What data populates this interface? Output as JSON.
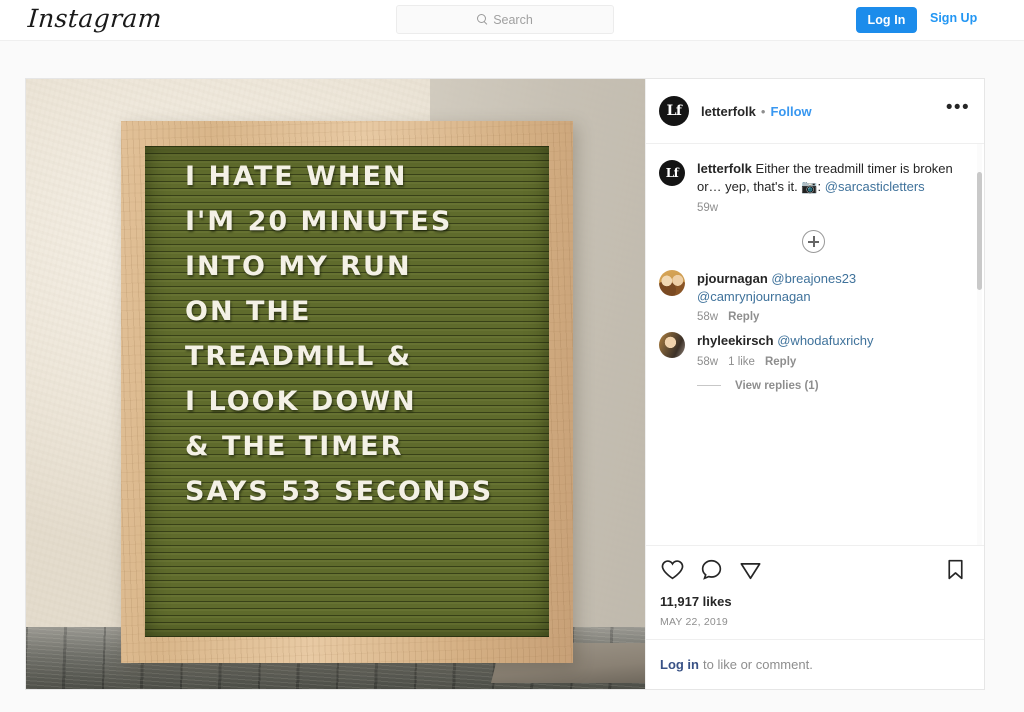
{
  "header": {
    "logo": "Instagram",
    "search": {
      "placeholder": "Search",
      "value": "",
      "icon": "search-icon"
    },
    "login_label": "Log In",
    "signup_label": "Sign Up",
    "accent_color": "#1c8ceb",
    "link_color": "#2296f3"
  },
  "photo": {
    "alt": "olive green felt letterboard in light wood frame on rustic wood floor",
    "board_lines": [
      "I  HATE  WHEN",
      "I'M  20  MINUTES",
      "INTO  MY  RUN",
      "ON  THE",
      "TREADMILL  &",
      "I  LOOK  DOWN",
      "&  THE  TIMER",
      "SAYS  53  SECONDS"
    ],
    "board_color": "#5f6b2c",
    "frame_color": "#dcb78e",
    "wall_color": "#ede6d9",
    "letter_color": "#f4f1e6"
  },
  "post_header": {
    "avatar_monogram": "Lf",
    "username": "letterfolk",
    "separator": "•",
    "follow_label": "Follow",
    "more_label": "•••"
  },
  "caption": {
    "avatar_monogram": "Lf",
    "username": "letterfolk",
    "text": " Either the treadmill timer is broken or… yep, that's it. 📷:",
    "mention": "@sarcasticletters",
    "timestamp": "59w"
  },
  "load_more": {
    "label": "+",
    "name": "load-more-comments"
  },
  "comments": [
    {
      "username": "pjournagan",
      "mentions": "@breajones23 @camrynjournagan",
      "timestamp": "58w",
      "likes": "",
      "reply_label": "Reply",
      "avatar": "photo-two-people"
    },
    {
      "username": "rhyleekirsch",
      "mentions": "@whodafuxrichy",
      "timestamp": "58w",
      "likes": "1 like",
      "reply_label": "Reply",
      "avatar": "photo-person"
    }
  ],
  "view_replies": "View replies (1)",
  "actions": {
    "like_icon": "heart-icon",
    "comment_icon": "speech-bubble-icon",
    "share_icon": "paper-plane-icon",
    "save_icon": "bookmark-icon",
    "likes_count": "11,917 likes",
    "date": "MAY 22, 2019"
  },
  "login_prompt": {
    "link": "Log in",
    "rest": "to like or comment."
  }
}
